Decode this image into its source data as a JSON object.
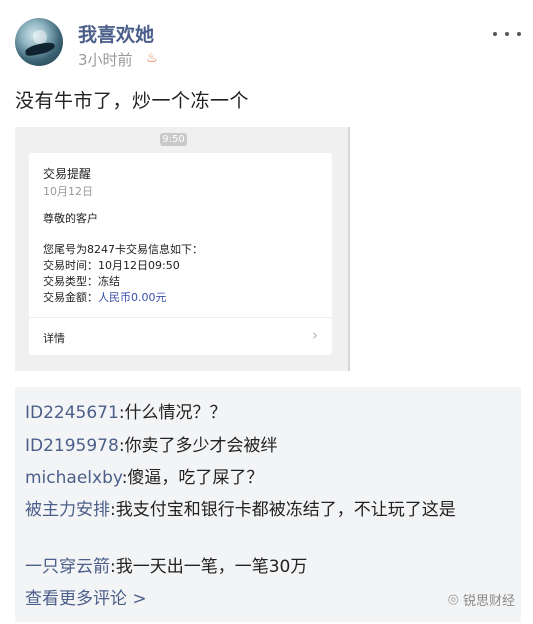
{
  "post": {
    "username": "我喜欢她",
    "time": "3小时前",
    "text": "没有牛市了，炒一个冻一个"
  },
  "image": {
    "clock": "9:50",
    "title": "交易提醒",
    "date": "10月12日",
    "greeting": "尊敬的客户",
    "lines": [
      "您尾号为8247卡交易信息如下：",
      "交易时间：10月12日09:50",
      "交易类型：冻结",
      "交易金额：",
      "人民币0.00元"
    ],
    "detail": "详情"
  },
  "comments": [
    {
      "user": "ID2245671",
      "text": ":什么情况？？"
    },
    {
      "user": "ID2195978",
      "text": ":你卖了多少才会被绊"
    },
    {
      "user": "michaelxby",
      "text": ":傻逼，吃了屎了？"
    },
    {
      "user": "被主力安排",
      "text": ":我支付宝和银行卡都被冻结了，不让玩了这是"
    },
    {
      "user": "一只穿云箭",
      "text": ":我一天出一笔，一笔30万"
    }
  ],
  "view_more": "查看更多评论 >",
  "watermark": "锐思财经",
  "icons": {
    "more": "more-dots-icon",
    "fire": "fire-icon",
    "chevron": "chevron-right-icon",
    "watermark": "wechat-icon"
  },
  "colors": {
    "link": "#4b5f8a",
    "background": "#ffffff",
    "comment_bg": "#f3f4f6"
  }
}
